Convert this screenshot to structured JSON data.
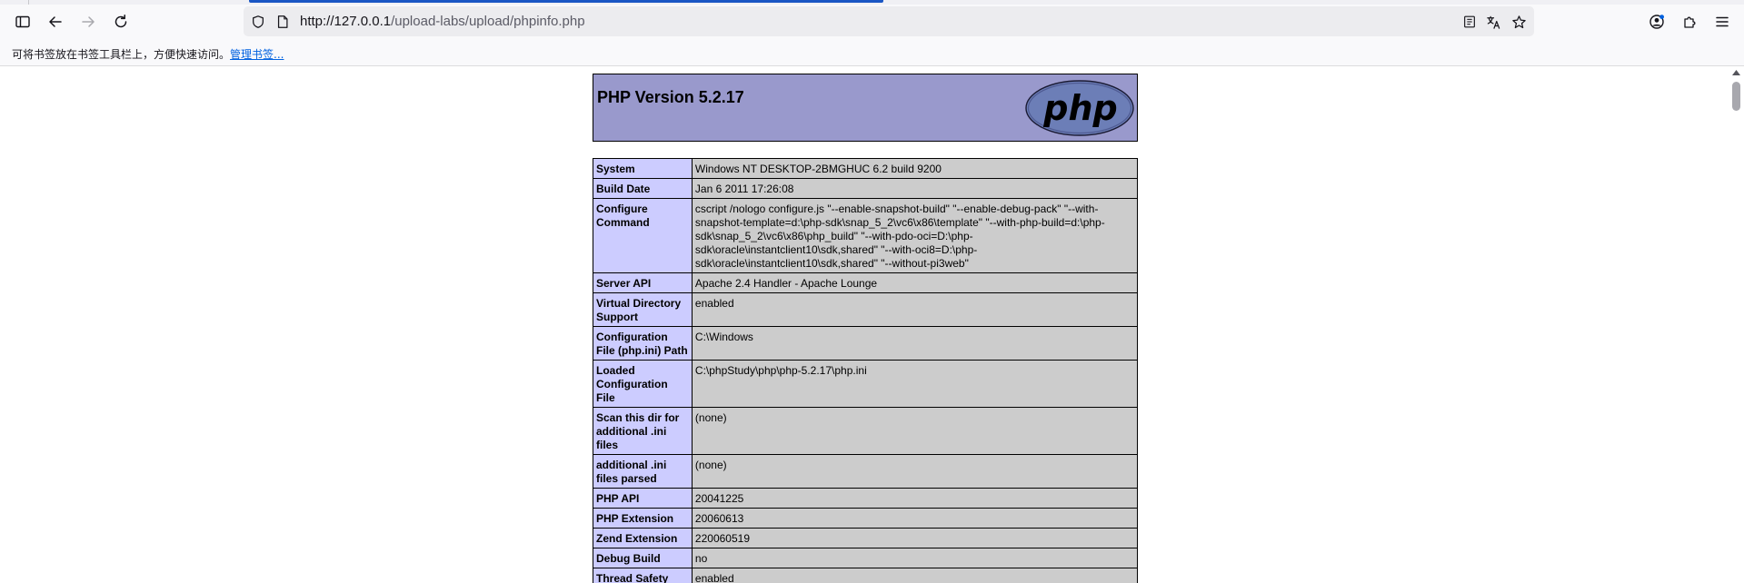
{
  "browser": {
    "url_prefix": "http://127.0.0.1",
    "url_path": "/upload-labs/upload/phpinfo.php",
    "bookmarks_hint": "可将书签放在书签工具栏上，方便快速访问。",
    "bookmarks_link": "管理书签..."
  },
  "page": {
    "php_version": "PHP Version 5.2.17",
    "logo_text": "php",
    "rows": [
      {
        "label": "System",
        "value": "Windows NT DESKTOP-2BMGHUC 6.2 build 9200"
      },
      {
        "label": "Build Date",
        "value": "Jan 6 2011 17:26:08"
      },
      {
        "label": "Configure Command",
        "value": "cscript /nologo configure.js \"--enable-snapshot-build\" \"--enable-debug-pack\" \"--with-snapshot-template=d:\\php-sdk\\snap_5_2\\vc6\\x86\\template\" \"--with-php-build=d:\\php-sdk\\snap_5_2\\vc6\\x86\\php_build\" \"--with-pdo-oci=D:\\php-sdk\\oracle\\instantclient10\\sdk,shared\" \"--with-oci8=D:\\php-sdk\\oracle\\instantclient10\\sdk,shared\" \"--without-pi3web\""
      },
      {
        "label": "Server API",
        "value": "Apache 2.4 Handler - Apache Lounge"
      },
      {
        "label": "Virtual Directory Support",
        "value": "enabled"
      },
      {
        "label": "Configuration File (php.ini) Path",
        "value": "C:\\Windows"
      },
      {
        "label": "Loaded Configuration File",
        "value": "C:\\phpStudy\\php\\php-5.2.17\\php.ini"
      },
      {
        "label": "Scan this dir for additional .ini files",
        "value": "(none)"
      },
      {
        "label": "additional .ini files parsed",
        "value": "(none)"
      },
      {
        "label": "PHP API",
        "value": "20041225"
      },
      {
        "label": "PHP Extension",
        "value": "20060613"
      },
      {
        "label": "Zend Extension",
        "value": "220060519"
      },
      {
        "label": "Debug Build",
        "value": "no"
      },
      {
        "label": "Thread Safety",
        "value": "enabled"
      }
    ]
  },
  "colors": {
    "header_bg": "#9999cc",
    "label_bg": "#ccccff",
    "value_bg": "#cccccc",
    "active_tab": "#1a56c4",
    "link": "#0061e0"
  }
}
